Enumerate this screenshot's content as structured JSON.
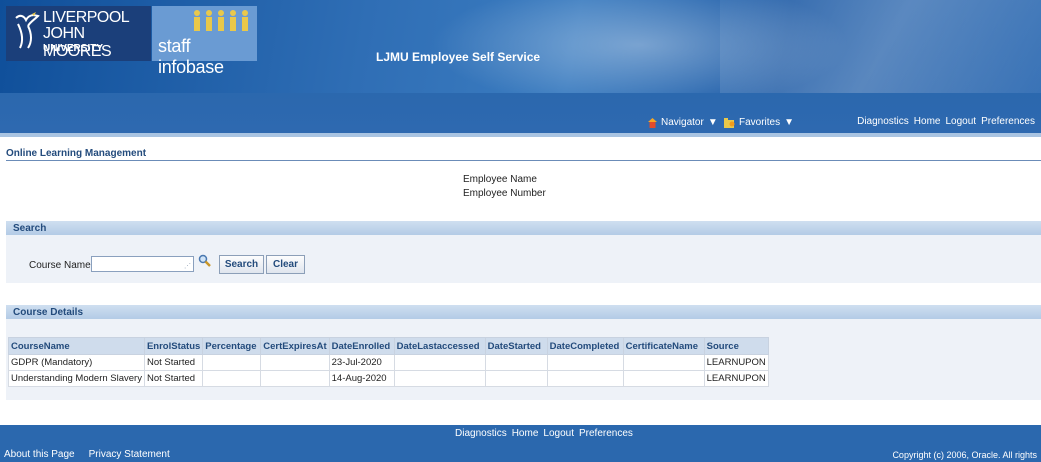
{
  "branding": {
    "university_line1": "LIVERPOOL",
    "university_line2": "JOHN MOORES",
    "university_line3": "UNIVERSITY",
    "infobase": "staff infobase",
    "app_title": "LJMU Employee Self Service"
  },
  "nav": {
    "navigator": "Navigator",
    "favorites": "Favorites",
    "links": [
      "Diagnostics",
      "Home",
      "Logout",
      "Preferences"
    ]
  },
  "section": {
    "title": "Online Learning Management"
  },
  "employee": {
    "name_label": "Employee Name",
    "number_label": "Employee Number"
  },
  "search": {
    "header": "Search",
    "course_label": "Course Name",
    "course_value": "",
    "search_button": "Search",
    "clear_button": "Clear"
  },
  "course_details": {
    "header": "Course Details",
    "columns": [
      "CourseName",
      "EnrolStatus",
      "Percentage",
      "CertExpiresAt",
      "DateEnrolled",
      "DateLastaccessed",
      "DateStarted",
      "DateCompleted",
      "CertificateName",
      "Source"
    ],
    "rows": [
      [
        "GDPR (Mandatory)",
        "Not Started",
        "",
        "",
        "23-Jul-2020",
        "",
        "",
        "",
        "",
        "LEARNUPON"
      ],
      [
        "Understanding Modern Slavery",
        "Not Started",
        "",
        "",
        "14-Aug-2020",
        "",
        "",
        "",
        "",
        "LEARNUPON"
      ]
    ]
  },
  "footer": {
    "links": [
      "Diagnostics",
      "Home",
      "Logout",
      "Preferences"
    ],
    "about": "About this Page",
    "privacy": "Privacy Statement",
    "copyright": "Copyright (c) 2006, Oracle. All rights"
  }
}
